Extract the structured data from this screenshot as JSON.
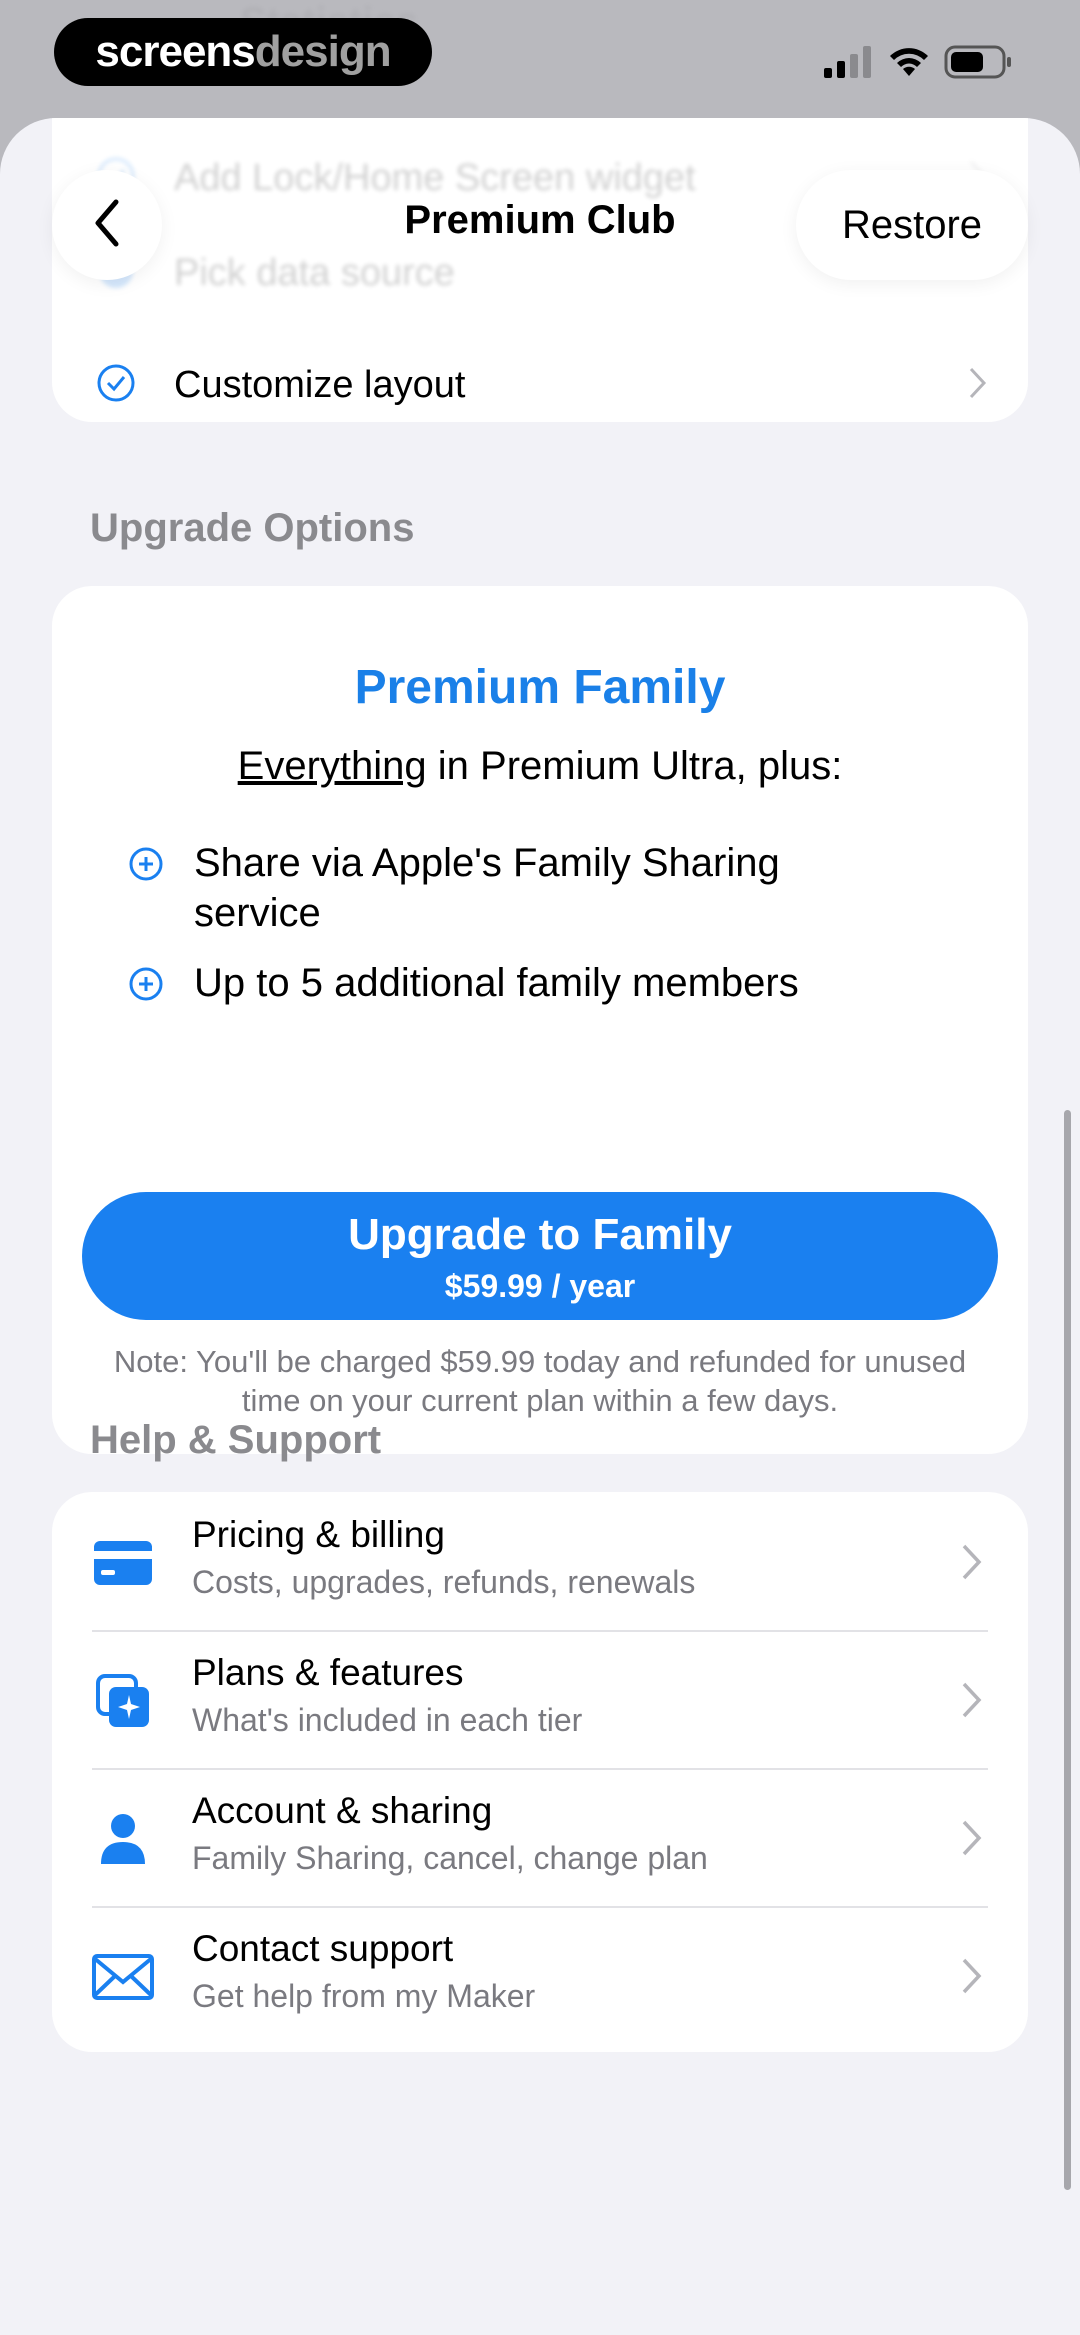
{
  "statusbar": {
    "brand_bold": "screens",
    "brand_light": "design",
    "ghost_text": "Statistics"
  },
  "nav": {
    "title": "Premium Club",
    "restore_label": "Restore"
  },
  "previous_features": {
    "items": [
      {
        "label": "Add Lock/Home Screen widget"
      },
      {
        "label": "Pick data source"
      },
      {
        "label": "Customize layout"
      }
    ]
  },
  "upgrade": {
    "section_title": "Upgrade Options",
    "plan_name": "Premium Family",
    "subtitle_underlined": "Everything",
    "subtitle_rest": " in Premium Ultra, plus:",
    "features": [
      {
        "text": "Share via Apple's Family Sharing service"
      },
      {
        "text": "Up to 5 additional family members"
      }
    ],
    "cta_label": "Upgrade to Family",
    "cta_price": "$59.99 / year",
    "note": "Note: You'll be charged $59.99 today and refunded for unused time on your current plan within a few days."
  },
  "help": {
    "section_title": "Help & Support",
    "items": [
      {
        "title": "Pricing & billing",
        "subtitle": "Costs, upgrades, refunds, renewals",
        "icon": "credit-card-icon"
      },
      {
        "title": "Plans & features",
        "subtitle": "What's included in each tier",
        "icon": "sparkle-stack-icon"
      },
      {
        "title": "Account & sharing",
        "subtitle": "Family Sharing, cancel, change plan",
        "icon": "person-icon"
      },
      {
        "title": "Contact support",
        "subtitle": "Get help from my Maker",
        "icon": "envelope-icon"
      }
    ]
  },
  "colors": {
    "accent": "#1a80f0",
    "plan_title": "#1a80e8",
    "secondary_text": "#7a7a80",
    "section_title": "#8a8a8e",
    "sheet_bg": "#f2f2f7"
  }
}
